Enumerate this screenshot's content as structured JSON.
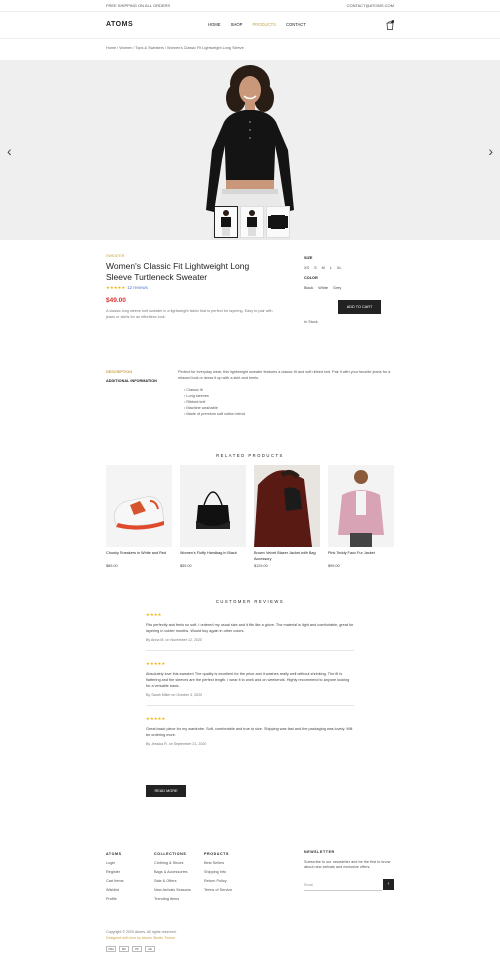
{
  "topbar": {
    "left": "FREE SHIPPING ON ALL ORDERS",
    "right": "CONTACT@ATOMS.COM"
  },
  "header": {
    "logo": "ATOMS",
    "nav": [
      "HOME",
      "SHOP",
      "PRODUCTS",
      "CONTACT"
    ],
    "active_nav": "PRODUCTS",
    "cart_count": "0"
  },
  "breadcrumb": "Home / Women / Tops & Sweaters / Women's Classic Fit Lightweight Long Sleeve",
  "hero": {
    "prev_icon": "chevron-left-icon",
    "next_icon": "chevron-right-icon"
  },
  "product": {
    "category": "SWEATER",
    "title": "Women's Classic Fit Lightweight Long Sleeve Turtleneck Sweater",
    "rating": "★★★★★",
    "rating_count": "12 reviews",
    "price": "$49.00",
    "description": "A classic long sleeve knit sweater in a lightweight fabric that is perfect for layering. Easy to pair with jeans or skirts for an effortless look."
  },
  "options": {
    "size_label": "SIZE",
    "sizes": [
      "XS",
      "S",
      "M",
      "L",
      "XL"
    ],
    "color_label": "COLOR",
    "colors": [
      "Black",
      "White",
      "Grey"
    ],
    "add_to_cart": "ADD TO CART",
    "stock": "In Stock"
  },
  "details": {
    "tab_active": "DESCRIPTION",
    "tab_other": "ADDITIONAL INFORMATION",
    "text": "Perfect for everyday wear, this lightweight sweater features a classic fit and soft ribbed knit. Pair it with your favorite jeans for a relaxed look or dress it up with a skirt and heels.",
    "bullets": [
      "Classic fit",
      "Long sleeves",
      "Ribbed knit",
      "Machine washable",
      "Made of premium soft cotton blend"
    ]
  },
  "related": {
    "title": "RELATED PRODUCTS",
    "items": [
      {
        "name": "Chunky Sneakers in White and Red",
        "price": "$89.00"
      },
      {
        "name": "Women's Fluffy Handbag in Black",
        "price": "$59.00"
      },
      {
        "name": "Brown Velvet Blazer Jacket with Bag Accessory",
        "price": "$129.00"
      },
      {
        "name": "Pink Teddy Faux Fur Jacket",
        "price": "$99.00"
      }
    ]
  },
  "reviews": {
    "title": "CUSTOMER REVIEWS",
    "items": [
      {
        "stars": "★★★★",
        "text": "Fits perfectly and feels so soft. I ordered my usual size and it fits like a glove. The material is light and comfortable, great for layering in colder months. Would buy again in other colors.",
        "by": "By Anna M. on November 12, 2020"
      },
      {
        "stars": "★★★★★",
        "text": "Absolutely love this sweater! The quality is excellent for the price and it washes really well without shrinking. The fit is flattering and the sleeves are the perfect length. I wear it to work and on weekends. Highly recommend to anyone looking for a versatile basic.",
        "by": "By Sarah Miller on October 3, 2020"
      },
      {
        "stars": "★★★★★",
        "text": "Great basic piece for my wardrobe. Soft, comfortable and true to size. Shipping was fast and the packaging was lovely. Will be ordering more.",
        "by": "By Jessica R. on September 21, 2020"
      }
    ],
    "read_more": "READ MORE"
  },
  "footer": {
    "cols": [
      {
        "title": "ATOMS",
        "links": [
          "Login",
          "Register",
          "Cart Items",
          "Wishlist",
          "Profile"
        ]
      },
      {
        "title": "COLLECTIONS",
        "links": [
          "Clothing & Shoes",
          "Bags & Accessories",
          "Sale & Offers",
          "New Arrivals Seasons",
          "Trending Items"
        ]
      },
      {
        "title": "PRODUCTS",
        "links": [
          "Best Sellers",
          "Shipping Info",
          "Return Policy",
          "Terms of Service"
        ]
      }
    ],
    "newsletter_title": "NEWSLETTER",
    "newsletter_text": "Subscribe to our newsletter and be the first to know about new arrivals and exclusive offers.",
    "newsletter_placeholder": "Email",
    "newsletter_btn": "›",
    "copyright": "Copyright © 2020 Atoms. All rights reserved.",
    "credit": "Designed with love by Atoms Studio Theme"
  },
  "payments": [
    "VISA",
    "MC",
    "PP",
    "AE"
  ],
  "colors": {
    "accent": "#c9a14a",
    "price": "#dd3333",
    "dark": "#222222"
  }
}
